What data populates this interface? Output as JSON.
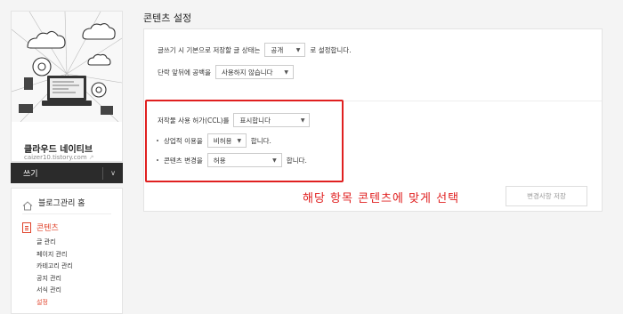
{
  "sidebar": {
    "blog_name": "클라우드 네이티브",
    "blog_url": "caizer10.tistory.com",
    "write_label": "쓰기",
    "home_label": "블로그관리 홈",
    "section_label": "콘텐츠",
    "submenu": [
      "글 관리",
      "페이지 관리",
      "카테고리 관리",
      "공지 관리",
      "서식 관리",
      "설정"
    ]
  },
  "main": {
    "title": "콘텐츠 설정",
    "default_state": {
      "prefix": "글쓰기 시 기본으로 저장할 글 상태는",
      "value": "공개",
      "suffix": "로 설정합니다."
    },
    "paragraph_spacing": {
      "prefix": "단락 앞뒤에 공백을",
      "value": "사용하지 않습니다"
    },
    "ccl": {
      "prefix": "저작물 사용 허가(CCL)를",
      "value": "표시합니다"
    },
    "commercial": {
      "prefix": "상업적 이용을",
      "value": "비허용",
      "suffix": "합니다."
    },
    "modification": {
      "prefix": "콘텐츠 변경을",
      "value": "허용",
      "suffix": "합니다."
    },
    "save_label": "변경사항 저장",
    "annotation": "해당 항목 콘텐츠에 맞게 선택"
  },
  "colors": {
    "accent": "#e0432b",
    "annotation": "#e02020",
    "write_bar": "#2b2b2b"
  }
}
